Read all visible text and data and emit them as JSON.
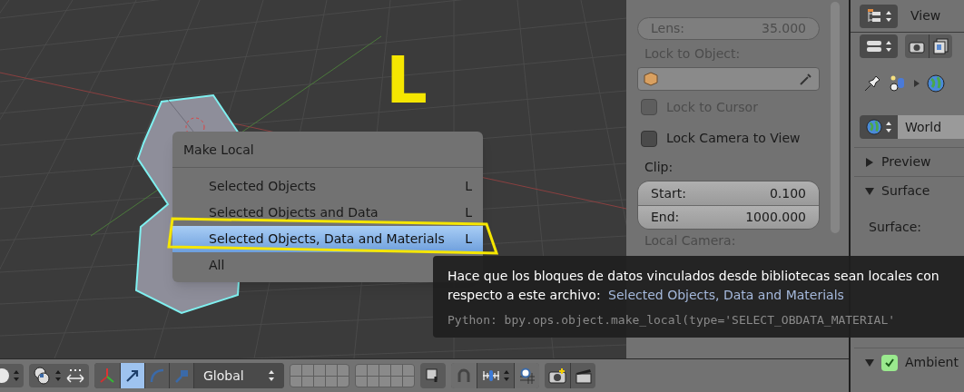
{
  "viewport": {
    "annotation_key": "L"
  },
  "menu": {
    "title": "Make Local",
    "items": [
      {
        "label": "Selected Objects",
        "shortcut": "L",
        "selected": false
      },
      {
        "label": "Selected Objects and Data",
        "shortcut": "L",
        "selected": false
      },
      {
        "label": "Selected Objects, Data and Materials",
        "shortcut": "L",
        "selected": true
      },
      {
        "label": "All",
        "selected": false
      }
    ]
  },
  "tooltip": {
    "text": "Hace que los bloques de datos vinculados desde bibliotecas sean locales con respecto a este archivo:",
    "value": "Selected Objects, Data and Materials",
    "python": "Python: bpy.ops.object.make_local(type='SELECT_OBDATA_MATERIAL'"
  },
  "view_panel": {
    "lens": {
      "label": "Lens:",
      "value": "35.000",
      "disabled": true
    },
    "lock_object_label": {
      "text": "Lock to Object:",
      "disabled": true
    },
    "checkboxes": [
      {
        "label": "Lock to Cursor",
        "checked": false,
        "disabled": true
      },
      {
        "label": "Lock Camera to View",
        "checked": false,
        "disabled": false
      }
    ],
    "clip_label": "Clip:",
    "clip": [
      {
        "label": "Start:",
        "value": "0.100"
      },
      {
        "label": "End:",
        "value": "1000.000"
      }
    ],
    "local_camera_label": {
      "text": "Local Camera:",
      "disabled": true
    }
  },
  "properties": {
    "view_label": "View",
    "world": "World",
    "sections": [
      {
        "title": "Preview",
        "expanded": false
      },
      {
        "title": "Surface",
        "expanded": true
      }
    ],
    "surface_label": "Surface:",
    "ambient": {
      "title": "Ambient",
      "expanded": true,
      "checked": true
    }
  },
  "header": {
    "transform_modes": [
      {
        "kind": "translate",
        "selected": true
      },
      {
        "kind": "rotate",
        "selected": false
      },
      {
        "kind": "scale",
        "selected": false
      }
    ],
    "orientation": "Global"
  }
}
